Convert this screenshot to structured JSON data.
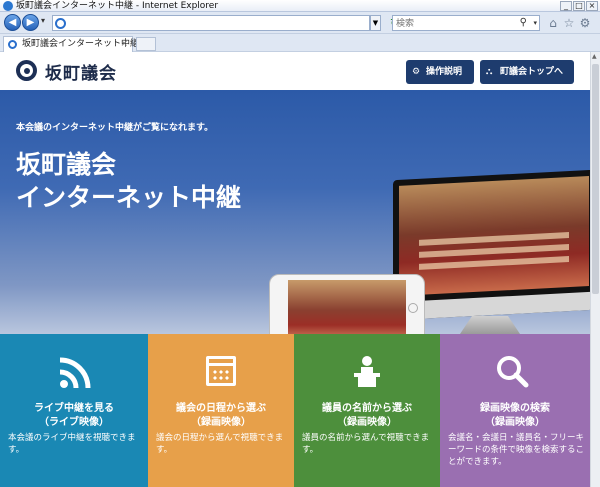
{
  "window": {
    "title": "坂町議会インターネット中継 - Internet Explorer",
    "controls": [
      "_",
      "□",
      "×"
    ]
  },
  "browser": {
    "address_value": "",
    "search_placeholder": "検索",
    "tab_label": "坂町議会インターネット中継"
  },
  "site": {
    "logo_text": "坂町議会",
    "buttons": {
      "guide": "操作説明",
      "council_top": "町議会トップへ"
    }
  },
  "hero": {
    "subtitle": "本会議のインターネット中継がご覧になれます。",
    "title_line1": "坂町議会",
    "title_line2": "インターネット中継"
  },
  "tiles": [
    {
      "title": "ライブ中継を見る\n（ライブ映像）",
      "desc": "本会議のライブ中継を視聴できます。",
      "color": "#1a88b4",
      "icon": "live-broadcast-icon"
    },
    {
      "title": "議会の日程から選ぶ\n（録画映像）",
      "desc": "議会の日程から選んで視聴できます。",
      "color": "#e7a04a",
      "icon": "calendar-icon"
    },
    {
      "title": "議員の名前から選ぶ\n（録画映像）",
      "desc": "議員の名前から選んで視聴できます。",
      "color": "#4d8f3c",
      "icon": "podium-speaker-icon"
    },
    {
      "title": "録画映像の検索\n（録画映像）",
      "desc": "会議名・会議日・議員名・フリーキーワードの条件で映像を検索することができます。",
      "color": "#9a6fb1",
      "icon": "search-icon"
    }
  ]
}
